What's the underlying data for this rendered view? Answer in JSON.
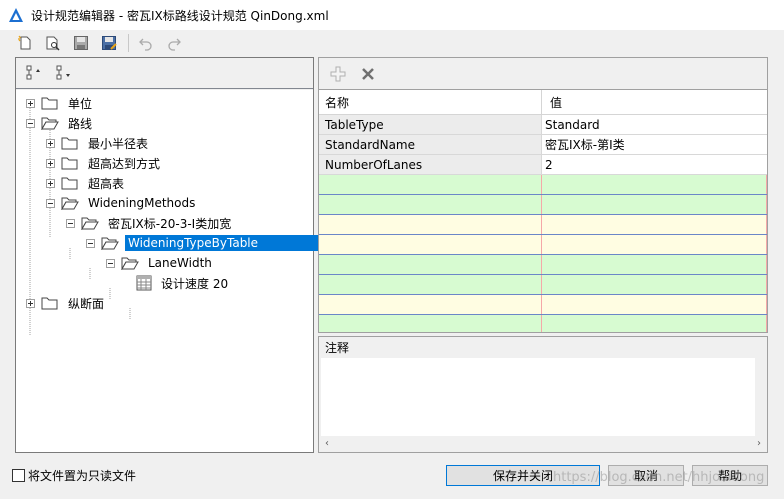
{
  "window": {
    "title": "设计规范编辑器 - 密瓦IX标路线设计规范 QinDong.xml"
  },
  "toolbar": {
    "buttons": [
      "new-file-icon",
      "open-file-icon",
      "save-icon",
      "save-as-icon",
      "undo-icon",
      "redo-icon"
    ]
  },
  "tree_tools": {
    "buttons": [
      "expand-all-icon",
      "collapse-all-icon"
    ]
  },
  "tree": {
    "nodes": [
      {
        "label": "单位",
        "icon": "folder-icon",
        "expander": "plus"
      },
      {
        "label": "路线",
        "icon": "folder-open-icon",
        "expander": "minus"
      },
      {
        "label": "最小半径表",
        "icon": "folder-icon",
        "expander": "plus"
      },
      {
        "label": "超高达到方式",
        "icon": "folder-icon",
        "expander": "plus"
      },
      {
        "label": "超高表",
        "icon": "folder-icon",
        "expander": "plus"
      },
      {
        "label": "WideningMethods",
        "icon": "folder-open-icon",
        "expander": "minus"
      },
      {
        "label": "密瓦IX标-20-3-I类加宽",
        "icon": "folder-open-icon",
        "expander": "minus"
      },
      {
        "label": "WideningTypeByTable",
        "icon": "folder-open-icon",
        "expander": "minus",
        "selected": true
      },
      {
        "label": "LaneWidth",
        "icon": "folder-open-icon",
        "expander": "minus"
      },
      {
        "label": "设计速度 20",
        "icon": "table-icon",
        "expander": "none"
      },
      {
        "label": "纵断面",
        "icon": "folder-icon",
        "expander": "plus"
      }
    ]
  },
  "property_tools": {
    "buttons": [
      "add-icon",
      "delete-icon"
    ]
  },
  "property_grid": {
    "headers": [
      "名称",
      "值"
    ],
    "rows": [
      {
        "name": "TableType",
        "value": "Standard"
      },
      {
        "name": "StandardName",
        "value": "密瓦IX标-第I类"
      },
      {
        "name": "NumberOfLanes",
        "value": "2"
      }
    ]
  },
  "notes": {
    "label": "注释"
  },
  "footer": {
    "readonly_label": "将文件置为只读文件",
    "save_close_label": "保存并关闭",
    "cancel_label": "取消",
    "help_label": "帮助"
  },
  "watermark": "https://blog.csdn.net/hhjoaidong",
  "colors": {
    "accent": "#0078d7",
    "grid_green": "#d7fbd1",
    "grid_yellow": "#fffde2"
  }
}
